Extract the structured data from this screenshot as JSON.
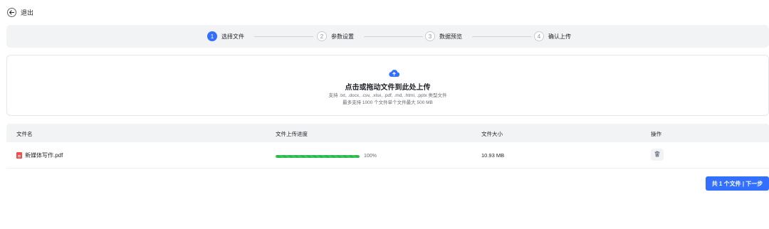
{
  "header": {
    "exit_label": "退出"
  },
  "steps": [
    {
      "num": "1",
      "label": "选择文件",
      "active": true
    },
    {
      "num": "2",
      "label": "参数设置",
      "active": false
    },
    {
      "num": "3",
      "label": "数据预览",
      "active": false
    },
    {
      "num": "4",
      "label": "确认上传",
      "active": false
    }
  ],
  "upload": {
    "title": "点击或拖动文件到此处上传",
    "supported_types": "支持 .txt, .docx, .csv, .xlsx, .pdf, .md, .html, .pptx 类型文件",
    "limits": "最多支持 1000 个文件单个文件最大 500 MB",
    "icon": "cloud-upload-icon",
    "accent_color": "#3370ff"
  },
  "table": {
    "headers": [
      "文件名",
      "文件上传进度",
      "文件大小",
      "操作"
    ],
    "rows": [
      {
        "name": "新媒体写作.pdf",
        "progress": 1.0,
        "progress_text": "100%",
        "size": "10.93 MB",
        "action_icon": "trash-icon"
      }
    ]
  },
  "footer": {
    "next_label": "共 1 个文件 | 下一步"
  },
  "colors": {
    "primary": "#3370ff",
    "progress": "#34c759",
    "file_icon": "#f54a45"
  }
}
